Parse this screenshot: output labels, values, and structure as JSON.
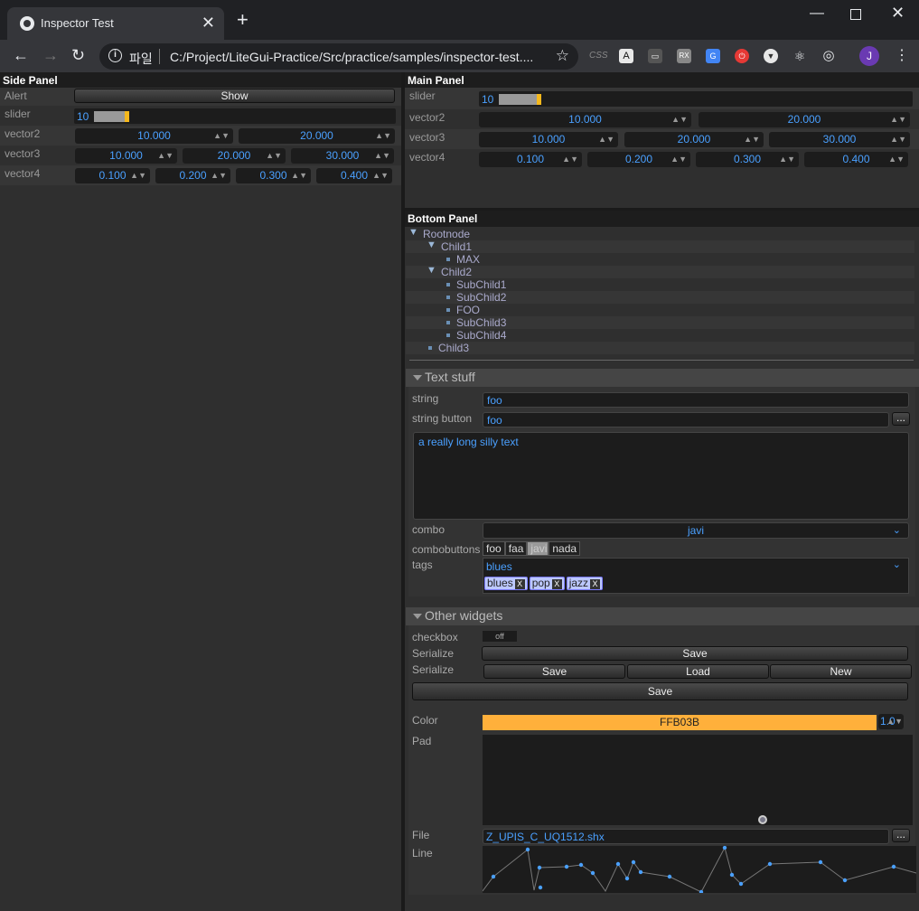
{
  "browser": {
    "tab_title": "Inspector Test",
    "scheme_label": "파일",
    "url": "C:/Project/LiteGui-Practice/Src/practice/samples/inspector-test....",
    "avatar_letter": "J",
    "ext_css": "CSS",
    "ext_text": "A",
    "ext_rx": "RX"
  },
  "side_panel": {
    "title": "Side Panel",
    "alert_label": "Alert",
    "show_button": "Show",
    "slider_label": "slider",
    "slider_value": "10",
    "slider_fraction": 0.1,
    "vector2_label": "vector2",
    "vector2": [
      "10.000",
      "20.000"
    ],
    "vector3_label": "vector3",
    "vector3": [
      "10.000",
      "20.000",
      "30.000"
    ],
    "vector4_label": "vector4",
    "vector4": [
      "0.100",
      "0.200",
      "0.300",
      "0.400"
    ]
  },
  "main_panel": {
    "title": "Main Panel",
    "slider_label": "slider",
    "slider_value": "10",
    "vector2_label": "vector2",
    "vector2": [
      "10.000",
      "20.000"
    ],
    "vector3_label": "vector3",
    "vector3": [
      "10.000",
      "20.000",
      "30.000"
    ],
    "vector4_label": "vector4",
    "vector4": [
      "0.100",
      "0.200",
      "0.300",
      "0.400"
    ]
  },
  "bottom_panel": {
    "title": "Bottom Panel",
    "tree": [
      "Rootnode",
      "Child1",
      "MAX",
      "Child2",
      "SubChild1",
      "SubChild2",
      "FOO",
      "SubChild3",
      "SubChild4",
      "Child3"
    ]
  },
  "text_stuff": {
    "title": "Text stuff",
    "string_label": "string",
    "string_value": "foo",
    "string_button_label": "string button",
    "string_button_value": "foo",
    "dots": "...",
    "textarea": "a really long silly text",
    "combo_label": "combo",
    "combo_value": "javi",
    "combobuttons_label": "combobuttons",
    "combobuttons": [
      "foo",
      "faa",
      "javi",
      "nada"
    ],
    "combobuttons_selected": "javi",
    "tags_label": "tags",
    "tags_select": "blues",
    "tags": [
      "blues",
      "pop",
      "jazz"
    ]
  },
  "other_widgets": {
    "title": "Other widgets",
    "checkbox_label": "checkbox",
    "checkbox_value": "off",
    "serialize_label": "Serialize",
    "save": "Save",
    "serialize2_label": "Serialize",
    "load": "Load",
    "new": "New",
    "save_full": "Save",
    "color_label": "Color",
    "color_value": "FFB03B",
    "color_hex": "#FFB03B",
    "alpha_value": "1.0",
    "pad_label": "Pad",
    "file_label": "File",
    "file_value": "Z_UPIS_C_UQ1512.shx",
    "line_label": "Line"
  }
}
